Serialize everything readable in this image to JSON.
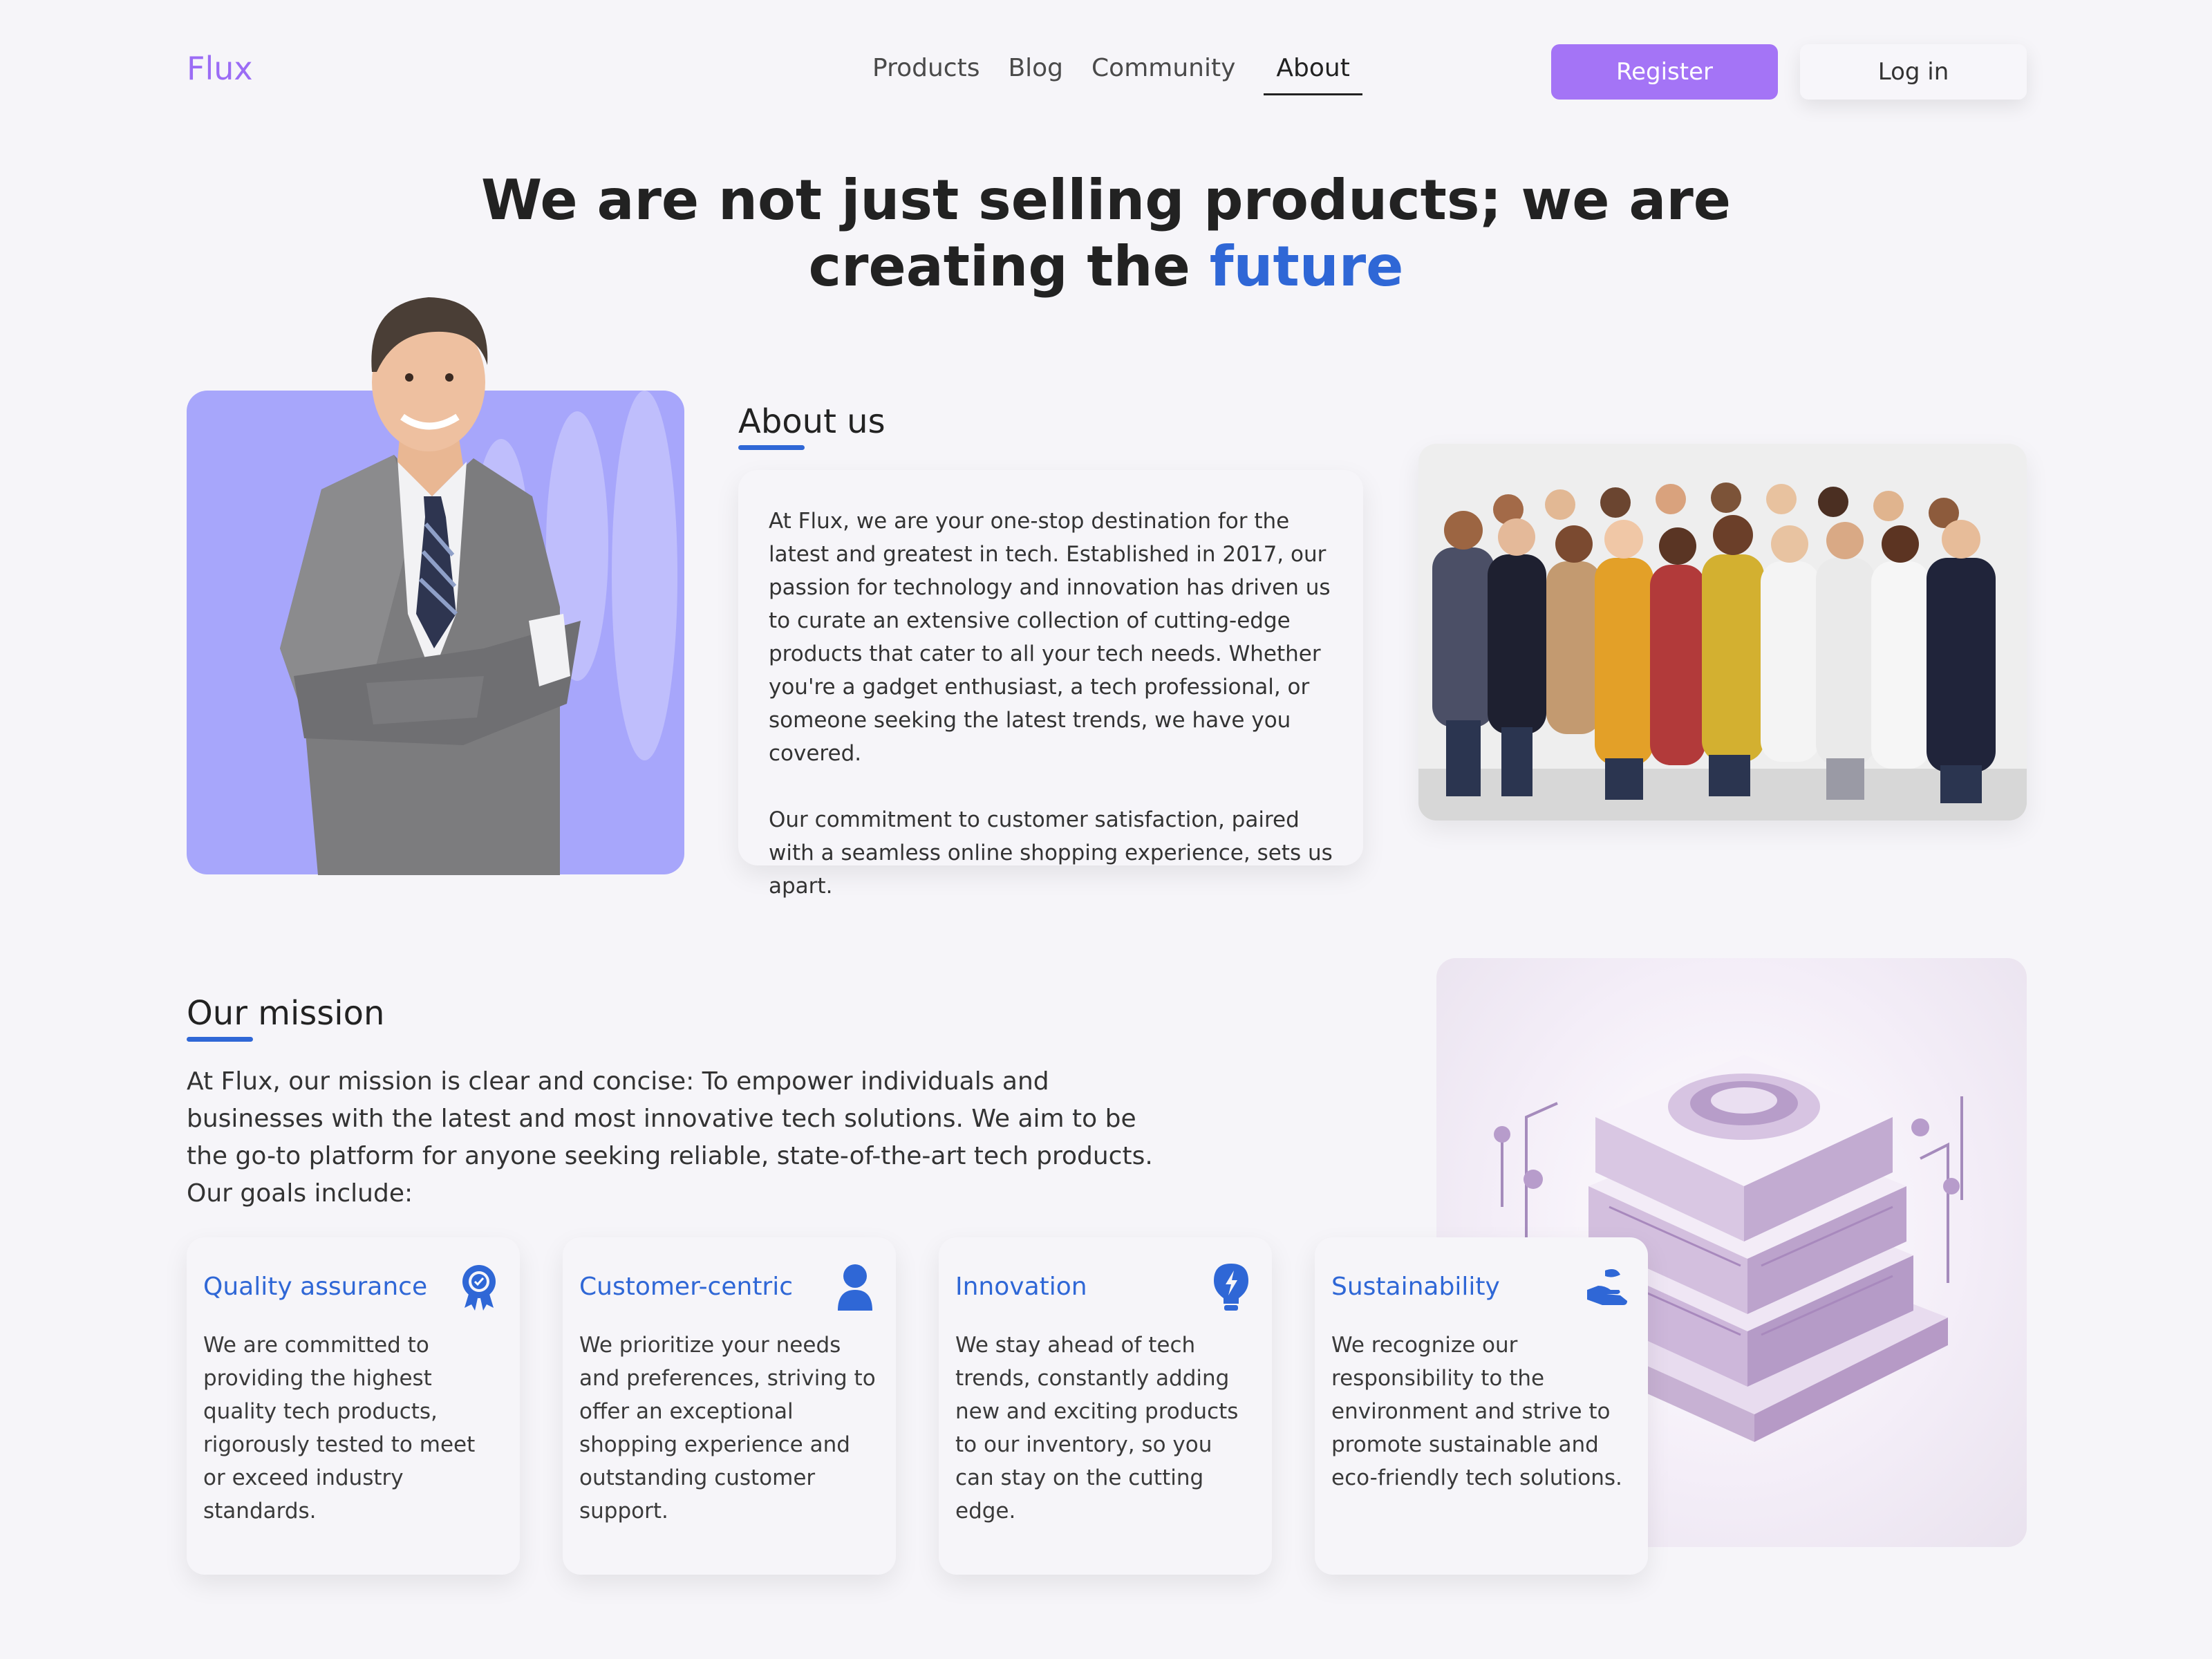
{
  "brand": {
    "name": "Flux"
  },
  "nav": {
    "items": [
      {
        "label": "Products"
      },
      {
        "label": "Blog"
      },
      {
        "label": "Community"
      },
      {
        "label": "About",
        "active": true
      }
    ],
    "register_label": "Register",
    "login_label": "Log in"
  },
  "hero": {
    "title_line1": "We are not just selling products; we are",
    "title_line2_prefix": "creating the ",
    "title_accent": "future"
  },
  "about": {
    "heading": "About us",
    "paragraph1": "At Flux, we are your one-stop destination for the latest and greatest in tech. Established in 2017, our passion for technology and innovation has driven us to curate an extensive collection of cutting-edge products that cater to all your tech needs. Whether you're a gadget enthusiast, a tech professional, or someone seeking the latest trends, we have you covered.",
    "paragraph2": "Our commitment to customer satisfaction, paired with a seamless online shopping experience, sets us apart."
  },
  "mission": {
    "heading": "Our mission",
    "text": "At Flux, our mission is clear and concise: To empower individuals and businesses with the latest and most innovative tech solutions. We aim to be the go-to platform for anyone seeking reliable, state-of-the-art tech products. Our goals include:",
    "goals": [
      {
        "title": "Quality assurance",
        "icon": "award-badge-icon",
        "text": "We are committed to providing the highest quality tech products, rigorously tested to meet or exceed industry standards."
      },
      {
        "title": "Customer-centric",
        "icon": "user-icon",
        "text": "We prioritize your needs and preferences, striving to offer an exceptional shopping experience and outstanding customer support."
      },
      {
        "title": "Innovation",
        "icon": "lightbulb-bolt-icon",
        "text": "We stay ahead of tech trends, constantly adding new and exciting products to our inventory, so you can stay on the cutting edge."
      },
      {
        "title": "Sustainability",
        "icon": "hand-leaf-icon",
        "text": "We recognize our responsibility to the environment and strive to promote sustainable and eco-friendly tech solutions."
      }
    ]
  },
  "colors": {
    "brand": "#9b6cf5",
    "register_button": "#a474f6",
    "accent_blue": "#2f67d6",
    "portrait_bg": "#a7a6fb",
    "page_bg": "#f6f5f9"
  }
}
